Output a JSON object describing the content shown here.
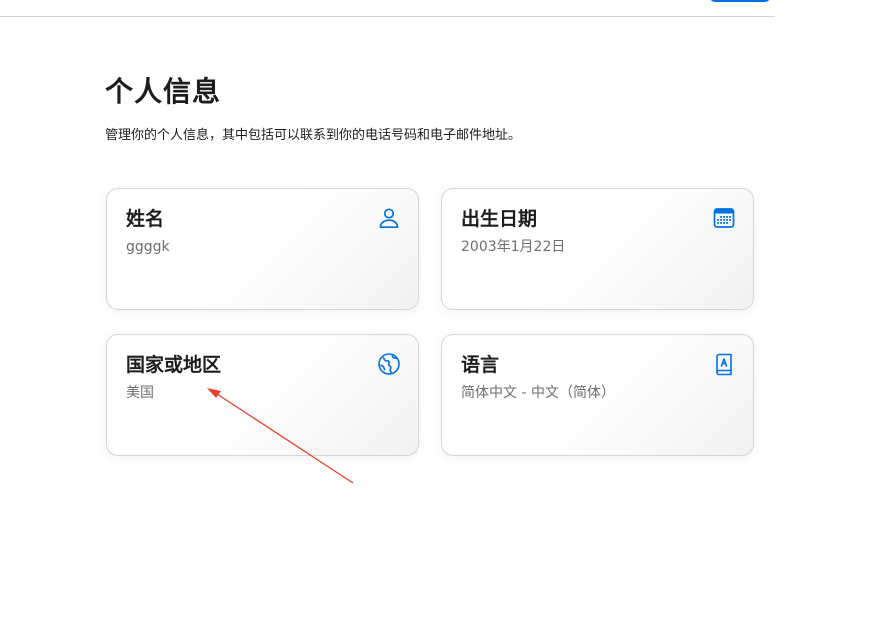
{
  "page": {
    "heading": "个人信息",
    "subtitle": "管理你的个人信息，其中包括可以联系到你的电话号码和电子邮件地址。"
  },
  "cards": [
    {
      "title": "姓名",
      "value": "ggggk",
      "icon": "person-icon"
    },
    {
      "title": "出生日期",
      "value": "2003年1月22日",
      "icon": "calendar-icon"
    },
    {
      "title": "国家或地区",
      "value": "美国",
      "icon": "globe-icon"
    },
    {
      "title": "语言",
      "value": "简体中文 - 中文（简体）",
      "icon": "language-book-icon"
    }
  ],
  "colors": {
    "accent": "#0071e3",
    "annotation": "#e8412e",
    "text_primary": "#1d1d1f",
    "text_secondary": "#6e6e73"
  }
}
